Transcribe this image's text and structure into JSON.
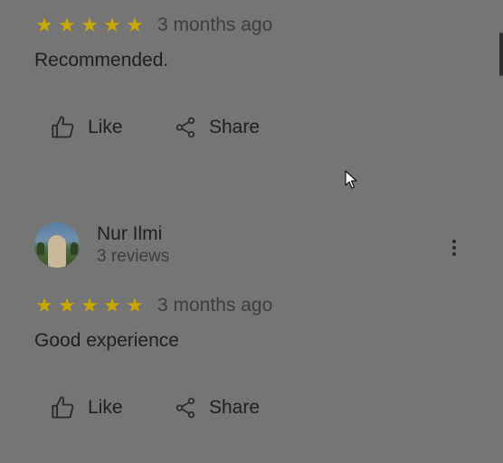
{
  "reviews": [
    {
      "rating": 5,
      "stars": [
        "★",
        "★",
        "★",
        "★",
        "★"
      ],
      "time": "3 months ago",
      "text": "Recommended.",
      "like_label": "Like",
      "share_label": "Share"
    },
    {
      "author": "Nur Ilmi",
      "author_reviews": "3 reviews",
      "rating": 5,
      "stars": [
        "★",
        "★",
        "★",
        "★",
        "★"
      ],
      "time": "3 months ago",
      "text": "Good experience",
      "like_label": "Like",
      "share_label": "Share"
    }
  ],
  "colors": {
    "star": "#c9a800",
    "overlay": "#757575"
  },
  "icons": [
    "thumbs-up-icon",
    "share-icon",
    "more-vert-icon",
    "mouse-pointer-icon"
  ]
}
